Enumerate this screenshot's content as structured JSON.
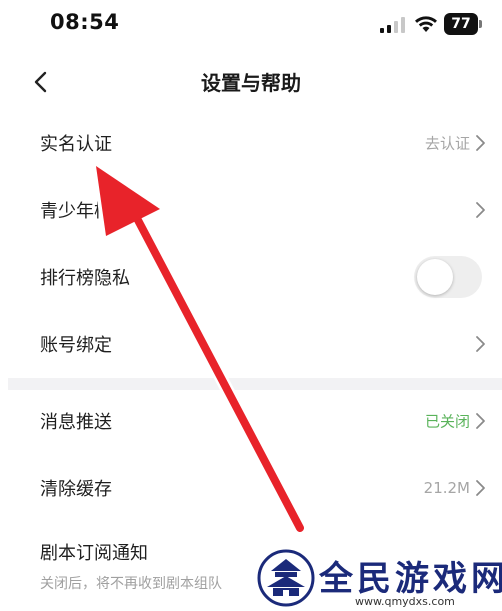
{
  "status_bar": {
    "time": "08:54",
    "battery": "77"
  },
  "nav": {
    "title": "设置与帮助",
    "back_icon": "chevron-left-icon"
  },
  "rows": [
    {
      "label": "实名认证",
      "value": "去认证",
      "control": "chevron"
    },
    {
      "label": "青少年模式",
      "value": "",
      "control": "chevron"
    },
    {
      "label": "排行榜隐私",
      "value": "",
      "control": "toggle",
      "toggle_on": false
    },
    {
      "label": "账号绑定",
      "value": "",
      "control": "chevron"
    },
    {
      "label": "消息推送",
      "value": "已关闭",
      "control": "chevron"
    },
    {
      "label": "清除缓存",
      "value": "21.2M",
      "control": "chevron"
    },
    {
      "label": "剧本订阅通知",
      "sub": "关闭后，将不再收到剧本组队",
      "control": "toggle"
    }
  ],
  "watermark": {
    "title": "全民游戏网",
    "url": "www.qmydxs.com"
  },
  "colors": {
    "arrow": "#e8232a",
    "value_gray": "#a6a6a6",
    "value_green": "#59b35a",
    "divider": "#f2f2f4"
  }
}
